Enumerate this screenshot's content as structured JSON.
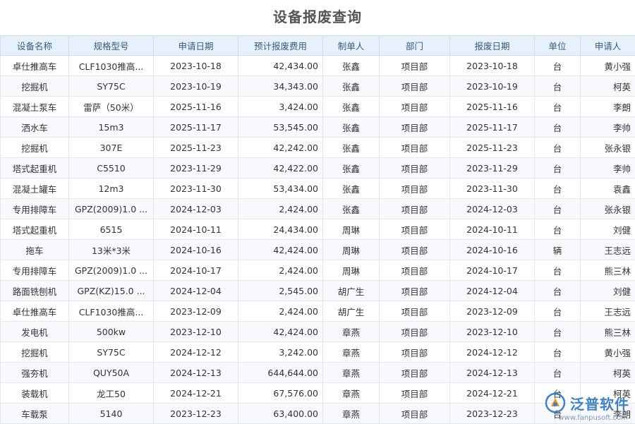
{
  "page": {
    "title": "设备报废查询"
  },
  "table": {
    "headers": [
      "设备名称",
      "规格型号",
      "申请日期",
      "预计报废费用",
      "制单人",
      "部门",
      "报废日期",
      "单位",
      "申请人"
    ],
    "rows": [
      [
        "卓仕推高车",
        "CLF1030推高...",
        "2023-10-18",
        "42,434.00",
        "张鑫",
        "项目部",
        "2023-10-18",
        "台",
        "黄小强"
      ],
      [
        "挖掘机",
        "SY75C",
        "2023-10-19",
        "34,343.00",
        "张鑫",
        "项目部",
        "2023-10-19",
        "台",
        "柯英"
      ],
      [
        "混凝土泵车",
        "雷萨（50米）",
        "2025-11-16",
        "3,424.00",
        "张鑫",
        "项目部",
        "2025-11-16",
        "台",
        "李朗"
      ],
      [
        "洒水车",
        "15m3",
        "2025-11-17",
        "53,545.00",
        "张鑫",
        "项目部",
        "2025-11-17",
        "台",
        "李帅"
      ],
      [
        "挖掘机",
        "307E",
        "2025-11-23",
        "42,242.00",
        "张鑫",
        "项目部",
        "2025-11-23",
        "台",
        "张永银"
      ],
      [
        "塔式起重机",
        "C5510",
        "2023-11-29",
        "42,422.00",
        "张鑫",
        "项目部",
        "2023-11-29",
        "台",
        "李帅"
      ],
      [
        "混凝土罐车",
        "12m3",
        "2023-11-30",
        "53,434.00",
        "张鑫",
        "项目部",
        "2023-11-30",
        "台",
        "袁鑫"
      ],
      [
        "专用排障车",
        "GPZ(2009)1.0 ...",
        "2024-12-03",
        "2,424.00",
        "张鑫",
        "项目部",
        "2024-12-03",
        "台",
        "张永银"
      ],
      [
        "塔式起重机",
        "6515",
        "2024-10-11",
        "24,434.00",
        "周琳",
        "项目部",
        "2024-10-11",
        "台",
        "刘健"
      ],
      [
        "拖车",
        "13米*3米",
        "2024-10-16",
        "42,424.00",
        "周琳",
        "项目部",
        "2024-10-16",
        "辆",
        "王志远"
      ],
      [
        "专用排障车",
        "GPZ(2009)1.0 ...",
        "2024-10-17",
        "2,424.00",
        "周琳",
        "项目部",
        "2024-10-17",
        "台",
        "熊三林"
      ],
      [
        "路面铣刨机",
        "GPZ(KZ)15.0 ...",
        "2024-12-04",
        "2,545.00",
        "胡广生",
        "项目部",
        "2024-12-04",
        "台",
        "刘健"
      ],
      [
        "卓仕推高车",
        "CLF1030推高...",
        "2023-12-09",
        "2,424.00",
        "胡广生",
        "项目部",
        "2023-12-09",
        "台",
        "王志远"
      ],
      [
        "发电机",
        "500kw",
        "2023-12-10",
        "42,424.00",
        "章燕",
        "项目部",
        "2023-12-10",
        "台",
        "熊三林"
      ],
      [
        "挖掘机",
        "SY75C",
        "2024-12-12",
        "3,242.00",
        "章燕",
        "项目部",
        "2024-12-12",
        "台",
        "黄小强"
      ],
      [
        "强夯机",
        "QUY50A",
        "2024-12-13",
        "644,644.00",
        "章燕",
        "项目部",
        "2024-12-13",
        "台",
        "柯英"
      ],
      [
        "装载机",
        "龙工50",
        "2024-12-21",
        "67,576.00",
        "章燕",
        "项目部",
        "2024-12-21",
        "台",
        "柯英"
      ],
      [
        "车载泵",
        "5140",
        "2023-12-23",
        "63,400.00",
        "章燕",
        "项目部",
        "2023-12-23",
        "台",
        "李朗"
      ]
    ]
  },
  "watermark": {
    "brand": "泛普软件",
    "url": "www.fanpusoft.com",
    "icon": "fanpu-logo-icon",
    "color": "#3577b8"
  }
}
